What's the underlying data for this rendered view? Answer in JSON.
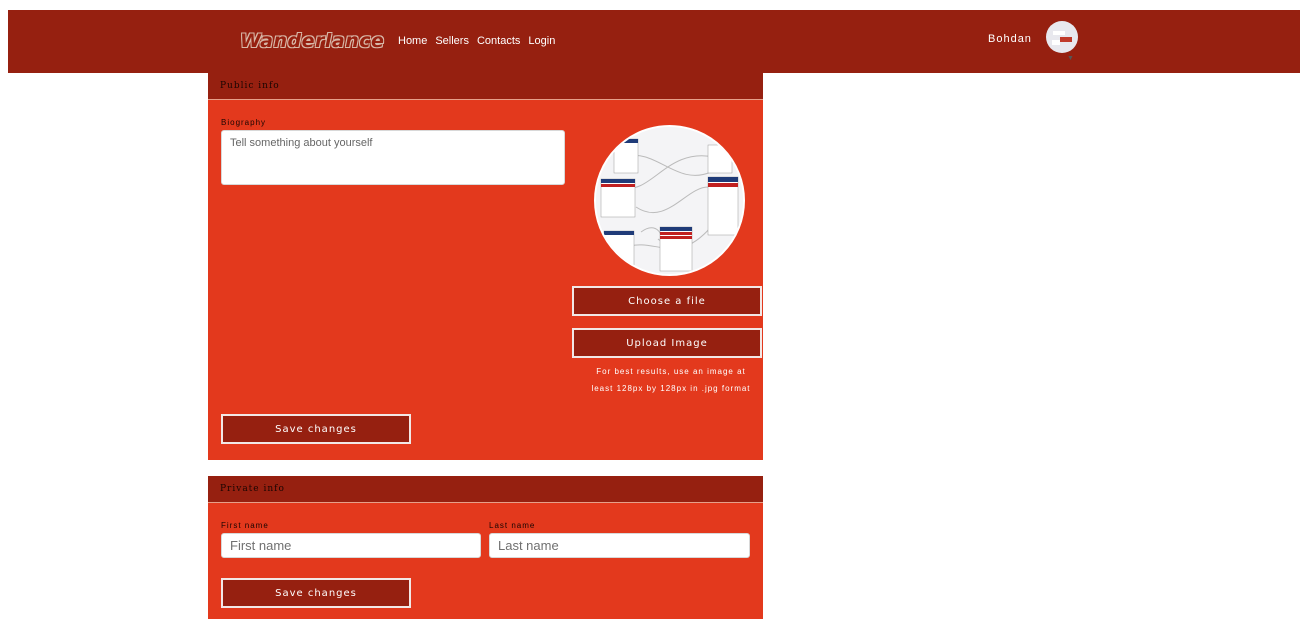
{
  "navbar": {
    "brand": "Wanderlance",
    "links": [
      "Home",
      "Sellers",
      "Contacts",
      "Login"
    ],
    "user_name": "Bohdan",
    "caret": "▼"
  },
  "public_info": {
    "header": "Public info",
    "biography_label": "Biography",
    "biography_placeholder": "Tell something about yourself",
    "choose_file_label": "Choose a file",
    "upload_image_label": "Upload Image",
    "hint": "For best results, use an image at least 128px by 128px in .jpg format",
    "save_label": "Save changes"
  },
  "private_info": {
    "header": "Private info",
    "first_name_label": "First name",
    "first_name_placeholder": "First name",
    "last_name_label": "Last name",
    "last_name_placeholder": "Last name",
    "save_label": "Save changes"
  },
  "colors": {
    "navbar": "#962010",
    "card": "#e3391d",
    "card_header": "#962010",
    "button": "#962010"
  }
}
